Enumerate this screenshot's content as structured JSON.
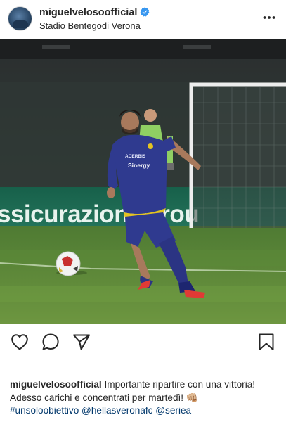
{
  "post": {
    "username": "miguelvelosoofficial",
    "location": "Stadio Bentegodi Verona",
    "verified": true
  },
  "photo": {
    "board_text": "ssicurazioni Grou",
    "sponsor_text": "Sinergy",
    "shirt_text": "ACERBIS"
  },
  "caption": {
    "username": "miguelvelosoofficial",
    "text": "Importante ripartire con una vittoria! Adesso carichi e concentrati per martedì! 👊🏼",
    "tags": "#unsoloobiettivo @hellasveronafc @seriea"
  },
  "icons": {
    "like": "heart-icon",
    "comment": "comment-icon",
    "share": "paper-plane-icon",
    "save": "bookmark-icon",
    "more": "more-options-icon",
    "verified": "verified-badge-icon"
  },
  "colors": {
    "text": "#262626",
    "link": "#00376b",
    "verified": "#3897f0",
    "pitch": "#5d8a3a",
    "ad_board": "#1f6e4e"
  }
}
